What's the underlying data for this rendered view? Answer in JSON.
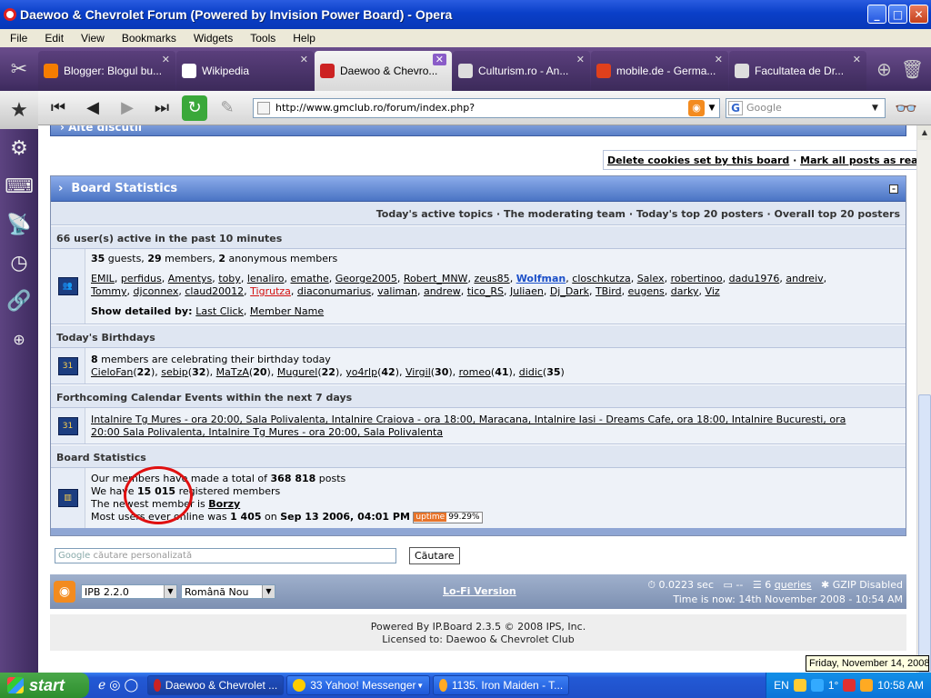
{
  "window": {
    "title": "Daewoo & Chevrolet Forum (Powered by Invision Power Board) - Opera"
  },
  "menu": [
    "File",
    "Edit",
    "View",
    "Bookmarks",
    "Widgets",
    "Tools",
    "Help"
  ],
  "tabs": [
    {
      "label": "Blogger: Blogul bu...",
      "active": false,
      "color": "#f57d00"
    },
    {
      "label": "Wikipedia",
      "active": false,
      "color": "#ffffff"
    },
    {
      "label": "Daewoo & Chevro...",
      "active": true,
      "color": "#cc2222"
    },
    {
      "label": "Culturism.ro - An...",
      "active": false,
      "color": "#dddddd"
    },
    {
      "label": "mobile.de - Germa...",
      "active": false,
      "color": "#e0401c"
    },
    {
      "label": "Facultatea de Dr...",
      "active": false,
      "color": "#dddddd"
    }
  ],
  "address": {
    "url": "http://www.gmclub.ro/forum/index.php?",
    "search_placeholder": "Google"
  },
  "forum": {
    "top_strip": "Alte discutii",
    "cookie_links": {
      "delete": "Delete cookies set by this board",
      "sep": " · ",
      "mark": "Mark all posts as read"
    },
    "stats_title": "Board Statistics",
    "top_links": "Today's active topics · The moderating team · Today's top 20 posters · Overall top 20 posters",
    "active_head": "66 user(s) active in the past 10 minutes",
    "active_summary": {
      "guests": "35",
      "guests_lbl": " guests, ",
      "members": "29",
      "members_lbl": " members, ",
      "anon": "2",
      "anon_lbl": " anonymous members"
    },
    "members_line1": [
      "EMIL",
      "perfidus",
      "Amentys",
      "toby",
      "lenaliro",
      "emathe",
      "George2005",
      "Robert_MNW",
      "zeus85",
      "Wolfman",
      "closchkutza",
      "Salex",
      "robertinoo",
      "dadu1976",
      "andreiv"
    ],
    "members_line2": [
      "Tommy",
      "djconnex",
      "claud20012",
      "Tigrutza",
      "diaconumarius",
      "valiman",
      "andrew",
      "tico_RS",
      "Juliaen",
      "Dj_Dark",
      "TBird",
      "eugens",
      "darky",
      "Viz"
    ],
    "detailed_lbl": "Show detailed by: ",
    "detailed_links": [
      "Last Click",
      "Member Name"
    ],
    "birthdays_head": "Today's Birthdays",
    "birthday_count": "8",
    "birthday_lbl": " members are celebrating their birthday today",
    "birthdays": [
      {
        "name": "CieloFan",
        "age": "22"
      },
      {
        "name": "sebip",
        "age": "32"
      },
      {
        "name": "MaTzA",
        "age": "20"
      },
      {
        "name": "Mugurel",
        "age": "22"
      },
      {
        "name": "yo4rlp",
        "age": "42"
      },
      {
        "name": "Virgil",
        "age": "30"
      },
      {
        "name": "romeo",
        "age": "41"
      },
      {
        "name": "didic",
        "age": "35"
      }
    ],
    "calendar_head": "Forthcoming Calendar Events within the next 7 days",
    "calendar_line1": "Intalnire Tg Mures - ora 20:00, Sala Polivalenta, Intalnire Craiova - ora 18:00, Maracana, Intalnire Iasi - Dreams Cafe, ora 18:00, Intalnire Bucuresti, ora",
    "calendar_line2": "20:00 Sala Polivalenta, Intalnire Tg Mures - ora 20:00, Sala Polivalenta",
    "board_stats_head": "Board Statistics",
    "posts_pre": "Our members have made a total of ",
    "posts": "368 818",
    "posts_post": " posts",
    "reg_pre": "We have ",
    "registered": "15 015",
    "reg_post": " registered members",
    "newest_pre": "The newest member is ",
    "newest": "Borzy",
    "online_pre": "Most users ever online was ",
    "online_count": "1 405",
    "online_on": " on ",
    "online_date": "Sep 13 2006, 04:01 PM",
    "uptime_lbl": "uptime",
    "uptime_pct": "99.29%"
  },
  "gsearch": {
    "brand": "Google",
    "placeholder": "căutare personalizată",
    "button": "Căutare"
  },
  "footer": {
    "skin": "IPB 2.2.0",
    "lang": "Română Nou",
    "lofi": "Lo-Fi Version",
    "time_sec": "0.0223 sec",
    "dashes": "--",
    "queries_n": "6",
    "queries": "queries",
    "gzip": "GZIP Disabled",
    "time_now": "Time is now: 14th November 2008 - 10:54 AM",
    "powered": "Powered By IP.Board 2.3.5 © 2008  IPS, Inc.",
    "licensed": "Licensed to: Daewoo & Chevrolet Club"
  },
  "tooltip": "Friday, November 14, 2008",
  "taskbar": {
    "start": "start",
    "tasks": [
      {
        "label": "Daewoo & Chevrolet ...",
        "active": true,
        "color": "#cc2222"
      },
      {
        "label": "33 Yahoo! Messenger",
        "active": false,
        "color": "#ffcc00"
      },
      {
        "label": "1135. Iron Maiden - T...",
        "active": false,
        "color": "#ffaa22"
      }
    ],
    "lang": "EN",
    "clock": "10:58 AM",
    "temp": "1°"
  },
  "colors": {
    "accent": "#5a80c8",
    "tabbar": "#3d2a5e",
    "highlight": "#e01010"
  }
}
